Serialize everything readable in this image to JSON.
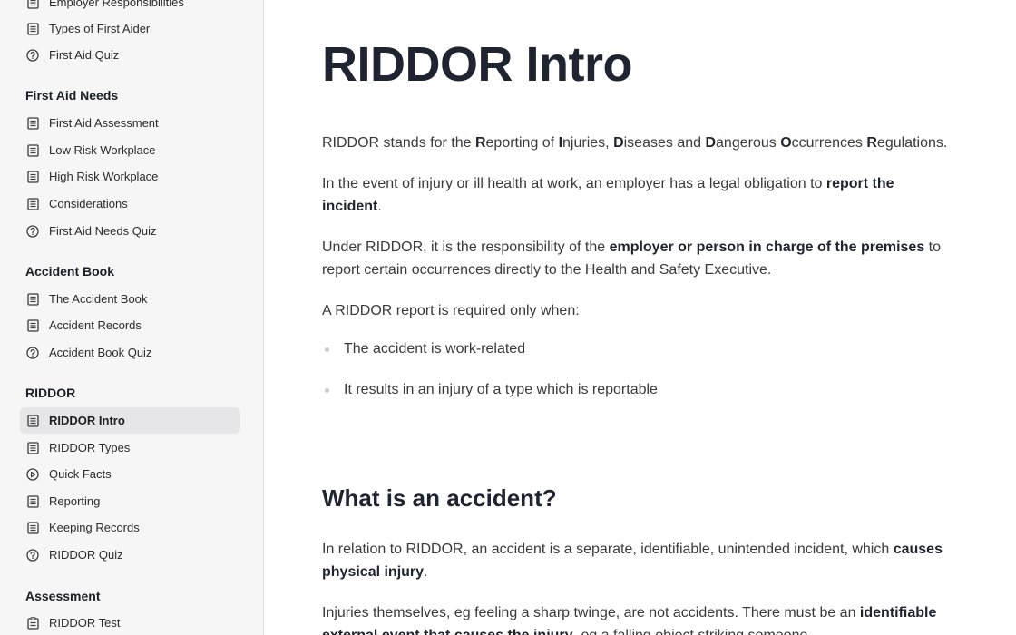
{
  "sidebar": {
    "sections": [
      {
        "heading": "",
        "items": [
          {
            "label": "Employer Responsibilities",
            "icon": "doc-icon"
          },
          {
            "label": "Types of First Aider",
            "icon": "doc-icon"
          },
          {
            "label": "First Aid Quiz",
            "icon": "quiz-icon"
          }
        ]
      },
      {
        "heading": "First Aid Needs",
        "items": [
          {
            "label": "First Aid Assessment",
            "icon": "doc-icon"
          },
          {
            "label": "Low Risk Workplace",
            "icon": "doc-icon"
          },
          {
            "label": "High Risk Workplace",
            "icon": "doc-icon"
          },
          {
            "label": "Considerations",
            "icon": "doc-icon"
          },
          {
            "label": "First Aid Needs Quiz",
            "icon": "quiz-icon"
          }
        ]
      },
      {
        "heading": "Accident Book",
        "items": [
          {
            "label": "The Accident Book",
            "icon": "doc-icon"
          },
          {
            "label": "Accident Records",
            "icon": "doc-icon"
          },
          {
            "label": "Accident Book Quiz",
            "icon": "quiz-icon"
          }
        ]
      },
      {
        "heading": "RIDDOR",
        "items": [
          {
            "label": "RIDDOR Intro",
            "icon": "doc-icon",
            "active": true
          },
          {
            "label": "RIDDOR Types",
            "icon": "doc-icon"
          },
          {
            "label": "Quick Facts",
            "icon": "play-icon"
          },
          {
            "label": "Reporting",
            "icon": "doc-icon"
          },
          {
            "label": "Keeping Records",
            "icon": "doc-icon"
          },
          {
            "label": "RIDDOR Quiz",
            "icon": "quiz-icon"
          }
        ]
      },
      {
        "heading": "Assessment",
        "items": [
          {
            "label": "RIDDOR Test",
            "icon": "clipboard-icon"
          }
        ]
      }
    ]
  },
  "content": {
    "title": "RIDDOR Intro",
    "p1": [
      {
        "t": "RIDDOR stands for the "
      },
      {
        "t": "R",
        "b": true
      },
      {
        "t": "eporting of "
      },
      {
        "t": "I",
        "b": true
      },
      {
        "t": "njuries, "
      },
      {
        "t": "D",
        "b": true
      },
      {
        "t": "iseases and "
      },
      {
        "t": "D",
        "b": true
      },
      {
        "t": "angerous "
      },
      {
        "t": "O",
        "b": true
      },
      {
        "t": "ccurrences "
      },
      {
        "t": "R",
        "b": true
      },
      {
        "t": "egulations."
      }
    ],
    "p2": [
      {
        "t": "In the event of injury or ill health at work, an employer has a legal obligation to "
      },
      {
        "t": "report the incident",
        "b": true
      },
      {
        "t": "."
      }
    ],
    "p3": [
      {
        "t": "Under RIDDOR, it is the responsibility of the "
      },
      {
        "t": "employer or person in charge of the premises",
        "b": true
      },
      {
        "t": " to report certain occurrences directly to the Health and Safety Executive."
      }
    ],
    "p4": "A RIDDOR report is required only when:",
    "bullets": [
      "The accident is work-related",
      "It results in an injury of a type which is reportable"
    ],
    "subheading": "What is an accident?",
    "p5": [
      {
        "t": "In relation to RIDDOR, an accident is a separate, identifiable, unintended incident, which "
      },
      {
        "t": "causes physical injury",
        "b": true
      },
      {
        "t": "."
      }
    ],
    "p6": [
      {
        "t": "Injuries themselves, eg feeling a sharp twinge, are not accidents. There must be an "
      },
      {
        "t": "identifiable external event that causes the injury",
        "b": true
      },
      {
        "t": ", eg a falling object striking someone."
      }
    ]
  },
  "colors": {
    "sidebar_bg": "#f6f6f6",
    "active_item_bg": "#e6e6e9",
    "heading_text": "#1f2430",
    "body_text": "#3a3a3a",
    "bullet_dot": "#c9c9c9"
  }
}
